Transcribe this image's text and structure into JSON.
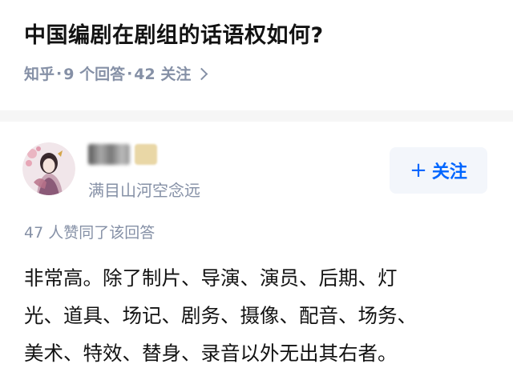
{
  "question": {
    "title": "中国编剧在剧组的话语权如何?",
    "source": "知乎",
    "sep1": "·",
    "answers_count": "9 个回答",
    "sep2": "·",
    "followers_count": "42 关注"
  },
  "answer": {
    "author": {
      "bio": "满目山河空念远"
    },
    "follow_label": "关注",
    "follow_icon": "plus-icon",
    "vote_text": "47 人赞同了该回答",
    "content_lines": [
      "非常高。除了制片、导演、演员、后期、灯",
      "光、道具、场记、剧务、摄像、配音、场务、",
      "美术、特效、替身、录音以外无出其右者。"
    ]
  },
  "colors": {
    "accent": "#0066ff",
    "muted": "#8590a6",
    "text": "#121212",
    "divider": "#f6f6f6",
    "follow_bg": "#f3f6fb"
  }
}
